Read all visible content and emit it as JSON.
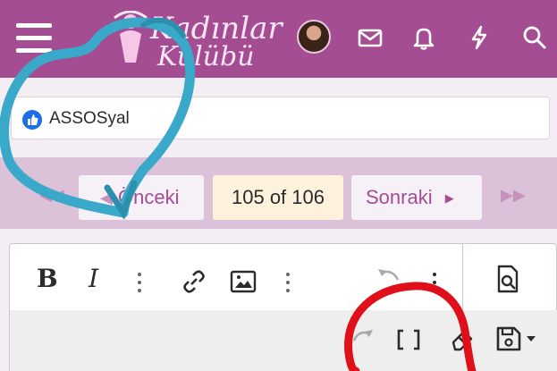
{
  "header": {
    "logo_line1": "Kadınlar",
    "logo_line2": "Kulübü",
    "menu_icon": "hamburger-menu-icon",
    "icons": [
      "envelope-icon",
      "bell-icon",
      "lightning-icon",
      "search-icon"
    ],
    "bg_color": "#a44d93"
  },
  "social": {
    "label": "ASSOSyal",
    "icon": "thumbs-up-icon"
  },
  "pager": {
    "prev_label": "Önceki",
    "current_label": "105 of 106",
    "next_label": "Sonraki"
  },
  "editor": {
    "bold_label": "B",
    "italic_label": "I",
    "tools": [
      "bold-icon",
      "italic-icon",
      "link-icon",
      "image-icon",
      "undo-icon",
      "more-icon",
      "preview-icon",
      "redo-icon",
      "brackets-icon",
      "eraser-icon",
      "save-draft-icon"
    ]
  },
  "overlay": {
    "heart_color": "#3aa9c9",
    "circle_color": "#e0101a"
  }
}
